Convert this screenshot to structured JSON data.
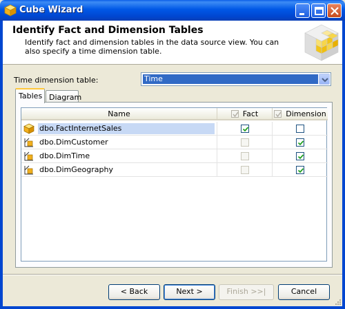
{
  "window": {
    "title": "Cube Wizard",
    "icon": "cube-wizard-icon"
  },
  "header": {
    "title": "Identify Fact and Dimension Tables",
    "description": "Identify fact and dimension tables in the data source view. You can also specify a time dimension table."
  },
  "time_dimension": {
    "label": "Time dimension table:",
    "value": "Time"
  },
  "tabs": [
    {
      "label": "Tables",
      "active": true
    },
    {
      "label": "Diagram",
      "active": false
    }
  ],
  "grid": {
    "columns": {
      "name": "Name",
      "fact": "Fact",
      "dimension": "Dimension"
    },
    "rows": [
      {
        "name": "dbo.FactInternetSales",
        "fact": true,
        "dimension": false,
        "selected": true,
        "icon": "fact-table-icon"
      },
      {
        "name": "dbo.DimCustomer",
        "fact": false,
        "dimension": true,
        "selected": false,
        "icon": "dimension-table-icon"
      },
      {
        "name": "dbo.DimTime",
        "fact": false,
        "dimension": true,
        "selected": false,
        "icon": "dimension-table-icon"
      },
      {
        "name": "dbo.DimGeography",
        "fact": false,
        "dimension": true,
        "selected": false,
        "icon": "dimension-table-icon"
      }
    ]
  },
  "buttons": {
    "back": "< Back",
    "next": "Next >",
    "finish": "Finish >>|",
    "cancel": "Cancel"
  },
  "colors": {
    "titlebar": "#0058e6",
    "selection": "#316ac5",
    "row_selection": "#c7d9f5"
  }
}
